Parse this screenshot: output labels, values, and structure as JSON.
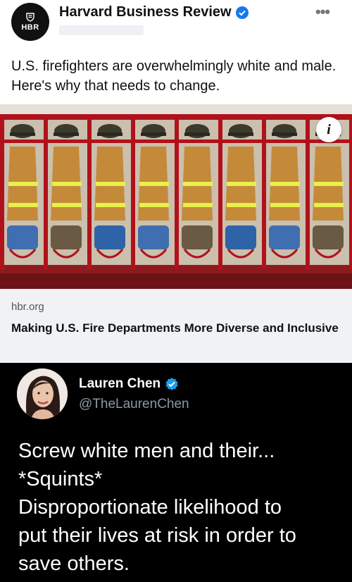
{
  "post": {
    "page_name": "Harvard Business Review",
    "avatar_text": "HBR",
    "text": "U.S. firefighters are overwhelmingly white and male. Here's why that needs to change.",
    "link": {
      "domain": "hbr.org",
      "title": "Making U.S. Fire Departments More Diverse and Inclusive"
    },
    "info_icon": "info-icon",
    "more_icon": "more-options-icon"
  },
  "tweet": {
    "name": "Lauren Chen",
    "handle": "@TheLaurenChen",
    "lines": [
      "Screw white men and their...",
      "*Squints*",
      "Disproportionate likelihood to",
      "put their lives at risk in order to",
      "save others."
    ]
  },
  "colors": {
    "verified_blue": "#1877f2",
    "twitter_verified": "#1d9bf0",
    "locker_red": "#b0121b",
    "dark_bg": "#000000"
  }
}
